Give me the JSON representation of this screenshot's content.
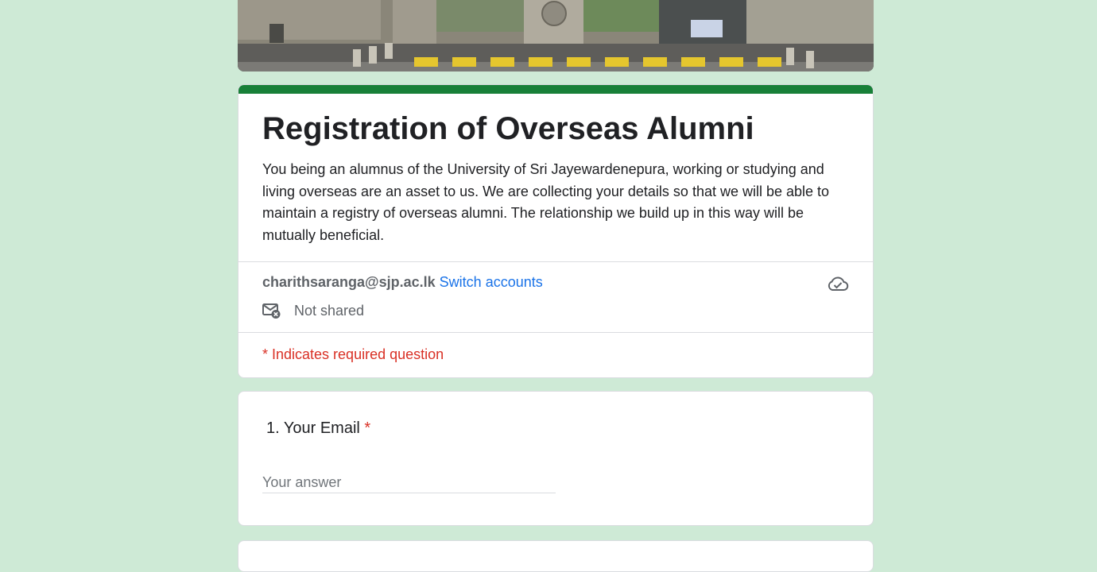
{
  "form": {
    "title": "Registration of Overseas Alumni",
    "description": "You being an alumnus of the University of Sri Jayewardenepura, working or studying and living overseas are an asset to us.  We are collecting your details so that we will be able to maintain a registry of overseas alumni. The relationship we build up in this way will be mutually beneficial.",
    "accent_color": "#188038",
    "background_color": "#ceead6"
  },
  "account": {
    "email": "charithsaranga@sjp.ac.lk",
    "switch_label": "Switch accounts",
    "sharing_status": "Not shared",
    "sharing_icon": "mail-not-shared-icon",
    "save_icon": "cloud-saved-icon"
  },
  "required_note": "* Indicates required question",
  "questions": [
    {
      "label": "1. Your Email",
      "required_marker": "*",
      "placeholder": "Your answer",
      "value": ""
    }
  ]
}
